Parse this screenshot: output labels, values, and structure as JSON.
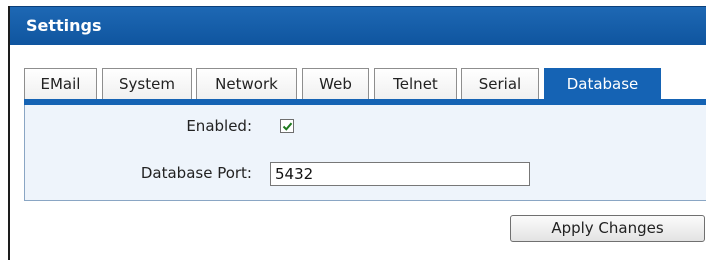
{
  "window": {
    "title": "Settings"
  },
  "tabs": [
    {
      "label": "EMail"
    },
    {
      "label": "System"
    },
    {
      "label": "Network"
    },
    {
      "label": "Web"
    },
    {
      "label": "Telnet"
    },
    {
      "label": "Serial"
    },
    {
      "label": "Database",
      "active": true
    }
  ],
  "form": {
    "enabled_label": "Enabled:",
    "enabled_checked": true,
    "port_label": "Database Port:",
    "port_value": "5432"
  },
  "actions": {
    "apply_label": "Apply Changes"
  },
  "colors": {
    "accent": "#1563b4",
    "panel_bg": "#eef4fb",
    "check": "#1e7a1e"
  }
}
